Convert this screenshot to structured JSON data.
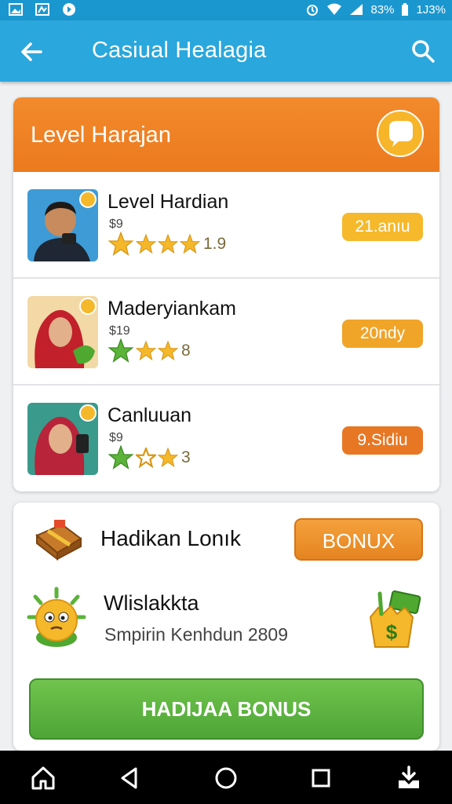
{
  "status_bar": {
    "battery_text": "1J3%",
    "signal_text": "83%",
    "icons": [
      "image-icon",
      "chart-icon",
      "circle-app-icon",
      "alarm-icon",
      "wifi-icon",
      "signal-icon",
      "battery-icon"
    ]
  },
  "app_bar": {
    "title": "Casiual Healagia",
    "back_icon": "arrow-left-icon",
    "search_icon": "search-icon"
  },
  "level_card": {
    "title": "Level Harajan",
    "chat_icon": "chat-bubble-icon",
    "rows": [
      {
        "name": "Level Hardian",
        "sub": "$9",
        "rating": 4,
        "count": "1.9",
        "pill": "21.anıu",
        "pill_color": "#f5b92b"
      },
      {
        "name": "Maderyiankam",
        "sub": "$19",
        "rating": 3,
        "count": "8",
        "pill": "20ndy",
        "pill_color": "#f0a428"
      },
      {
        "name": "Canluuan",
        "sub": "$9",
        "rating": 3,
        "count": "3",
        "pill": "9.Sidiu",
        "pill_color": "#e87724"
      }
    ]
  },
  "bonus_card": {
    "title": "Hadikan Lonık",
    "bonus_button": "BONUX",
    "subtitle": "Wlislakkta",
    "description": "Smpirin Kenhdun 2809",
    "action_button": "HADIJAA BONUS",
    "icons": [
      "treasure-chest-icon",
      "mascot-icon",
      "money-bag-icon"
    ]
  },
  "nav_bar": {
    "icons": [
      "home-icon",
      "back-triangle-icon",
      "home-circle-icon",
      "recents-square-icon",
      "download-icon"
    ]
  },
  "colors": {
    "primary": "#2aa7dc",
    "orange": "#ec7a1e",
    "green": "#4ea536",
    "star": "#f5b82a"
  }
}
